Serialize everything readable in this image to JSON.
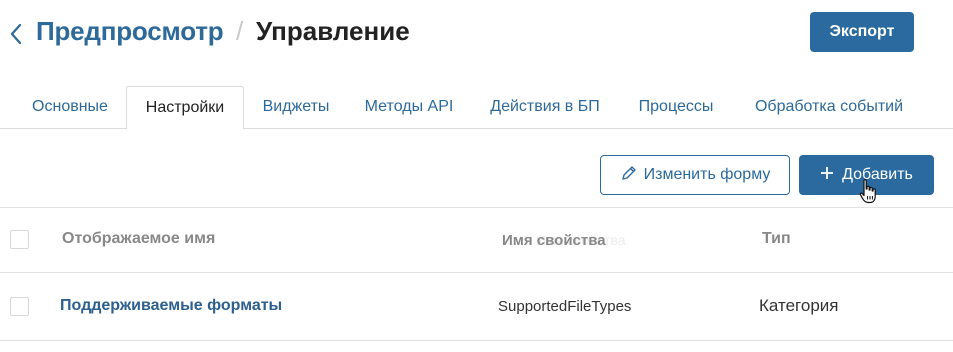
{
  "header": {
    "breadcrumb_parent": "Предпросмотр",
    "separator": "/",
    "current": "Управление",
    "export_label": "Экспорт"
  },
  "tabs": [
    {
      "label": "Основные",
      "active": false
    },
    {
      "label": "Настройки",
      "active": true
    },
    {
      "label": "Виджеты",
      "active": false
    },
    {
      "label": "Методы API",
      "active": false
    },
    {
      "label": "Действия в БП",
      "active": false
    },
    {
      "label": "Процессы",
      "active": false
    },
    {
      "label": "Обработка событий",
      "active": false
    }
  ],
  "toolbar": {
    "edit_form_label": "Изменить форму",
    "add_label": "Добавить"
  },
  "table": {
    "columns": [
      "Отображаемое имя",
      "Имя свойства",
      "Тип"
    ],
    "ghost_header": "Имя свойства",
    "rows": [
      {
        "name": "Поддерживаемые форматы",
        "property": "SupportedFileTypes",
        "type": "Категория"
      }
    ]
  },
  "colors": {
    "accent": "#2b6a9e",
    "link": "#2d6a9a",
    "border": "#dcdcdc"
  }
}
